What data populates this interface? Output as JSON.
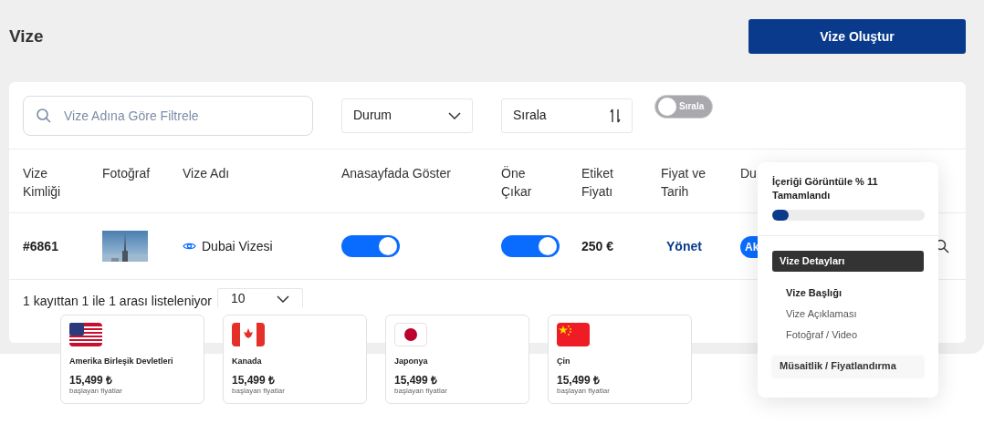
{
  "page_title": "Vize",
  "create_button": "Vize Oluştur",
  "filters": {
    "search_placeholder": "Vize Adına Göre Filtrele",
    "status_select": "Durum",
    "sort_select": "Sırala",
    "sort_toggle": {
      "label": "Sırala",
      "on": false
    }
  },
  "table": {
    "columns": [
      "Vize Kimliği",
      "Fotoğraf",
      "Vize Adı",
      "Anasayfada Göster",
      "Öne Çıkar",
      "Etiket Fiyatı",
      "Fiyat ve Tarih",
      "Du"
    ],
    "rows": [
      {
        "id": "#6861",
        "name": "Dubai Vizesi",
        "show_on_home": true,
        "featured": true,
        "price": "250 €",
        "manage_link": "Yönet",
        "status": "Ak"
      }
    ]
  },
  "footer": {
    "summary": "1 kayıttan 1 ile 1 arası listeleniyor",
    "page_size": "10"
  },
  "progress_panel": {
    "title": "İçeriği Görüntüle % 11 Tamamlandı",
    "level": 0.11,
    "sections": [
      {
        "label": "Vize Detayları",
        "selected": true,
        "children": [
          {
            "label": "Vize Başlığı",
            "selected": true
          },
          {
            "label": "Vize Açıklaması",
            "selected": false
          },
          {
            "label": "Fotoğraf / Video",
            "selected": false
          }
        ]
      },
      {
        "label": "Müsaitlik / Fiyatlandırma",
        "selected": false
      }
    ]
  },
  "country_cards": [
    {
      "kind": "us",
      "name": "Amerika Birleşik Devletleri",
      "price": "15,499 ₺",
      "note": "başlayan fiyatlar"
    },
    {
      "kind": "ca",
      "name": "Kanada",
      "price": "15,499 ₺",
      "note": "başlayan fiyatlar"
    },
    {
      "kind": "jp",
      "name": "Japonya",
      "price": "15,499 ₺",
      "note": "başlayan fiyatlar"
    },
    {
      "kind": "cn",
      "name": "Çin",
      "price": "15,499 ₺",
      "note": "başlayan fiyatlar"
    }
  ]
}
